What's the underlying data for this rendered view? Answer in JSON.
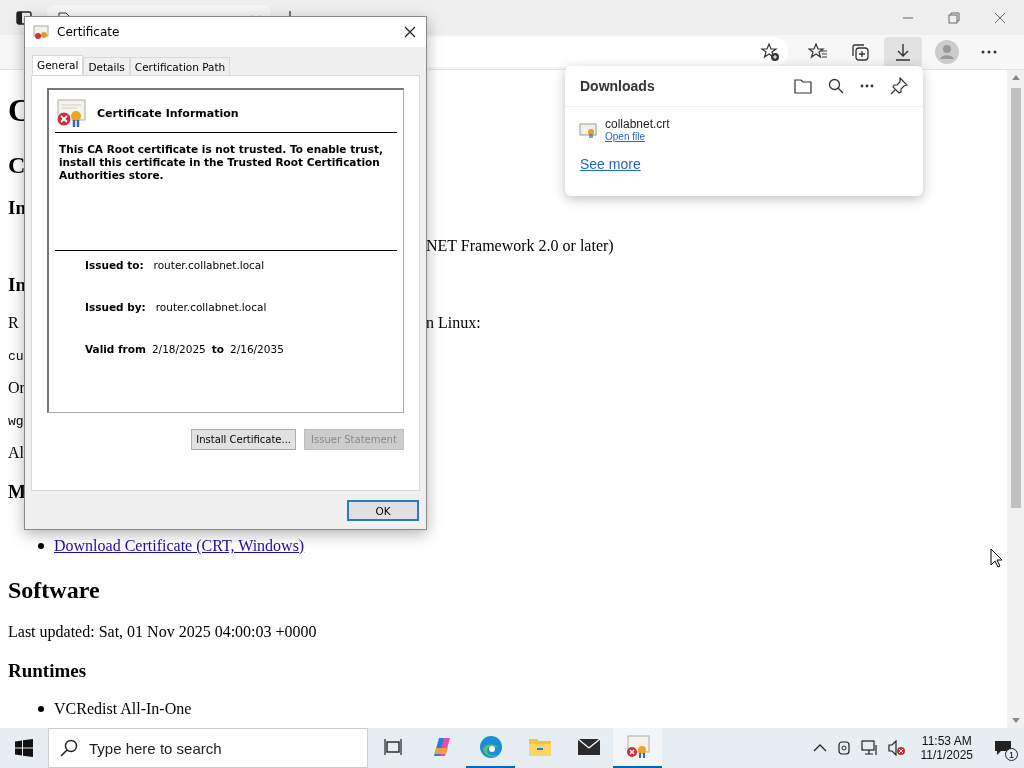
{
  "page": {
    "lines": [
      {
        "kind": "h1",
        "text": "C"
      },
      {
        "kind": "h2",
        "text": "C"
      },
      {
        "kind": "h3",
        "text": "In"
      },
      {
        "kind": "p",
        "right": "NET Framework 2.0 or later)"
      },
      {
        "kind": "h3",
        "text": "In"
      },
      {
        "kind": "p",
        "text": "R",
        "right": "n Linux:"
      },
      {
        "kind": "code",
        "text": "cu"
      },
      {
        "kind": "p",
        "text": "Or"
      },
      {
        "kind": "code",
        "text": "wg"
      },
      {
        "kind": "p",
        "text": "Al"
      },
      {
        "kind": "h3",
        "text": "M"
      },
      {
        "kind": "link",
        "text": "Download Certificate (CRT, Windows)"
      },
      {
        "kind": "h2",
        "text": "Software"
      },
      {
        "kind": "p",
        "text": "Last updated: Sat, 01 Nov 2025 04:00:03 +0000"
      },
      {
        "kind": "h3",
        "text": "Runtimes"
      },
      {
        "kind": "li",
        "text": "VCRedist All-In-One"
      }
    ]
  },
  "downloads": {
    "title": "Downloads",
    "items": [
      {
        "name": "collabnet.crt",
        "action": "Open file"
      }
    ],
    "see_more": "See more"
  },
  "dialog": {
    "title": "Certificate",
    "tabs": [
      {
        "label": "General",
        "selected": true
      },
      {
        "label": "Details",
        "selected": false
      },
      {
        "label": "Certification Path",
        "selected": false
      }
    ],
    "info_title": "Certificate Information",
    "message": "This CA Root certificate is not trusted. To enable trust, install this certificate in the Trusted Root Certification Authorities store.",
    "issued_to": {
      "label": "Issued to:",
      "value": "router.collabnet.local"
    },
    "issued_by": {
      "label": "Issued by:",
      "value": "router.collabnet.local"
    },
    "valid": {
      "label": "Valid from",
      "from": "2/18/2025",
      "to_label": "to",
      "to": "2/16/2035"
    },
    "buttons": [
      {
        "label": "Install Certificate...",
        "disabled": false
      },
      {
        "label": "Issuer Statement",
        "disabled": true
      }
    ],
    "ok": "OK"
  },
  "taskbar": {
    "search": {
      "placeholder": "Type here to search"
    },
    "apps": [
      {
        "kind": "taskview",
        "active": false
      },
      {
        "kind": "copilot",
        "active": false
      },
      {
        "kind": "edge",
        "active": true
      },
      {
        "kind": "folder",
        "active": false
      },
      {
        "kind": "mail",
        "active": false
      },
      {
        "kind": "certificate",
        "active": true
      }
    ],
    "time": "11:53 AM",
    "date": "11/1/2025",
    "notifications": "1"
  }
}
